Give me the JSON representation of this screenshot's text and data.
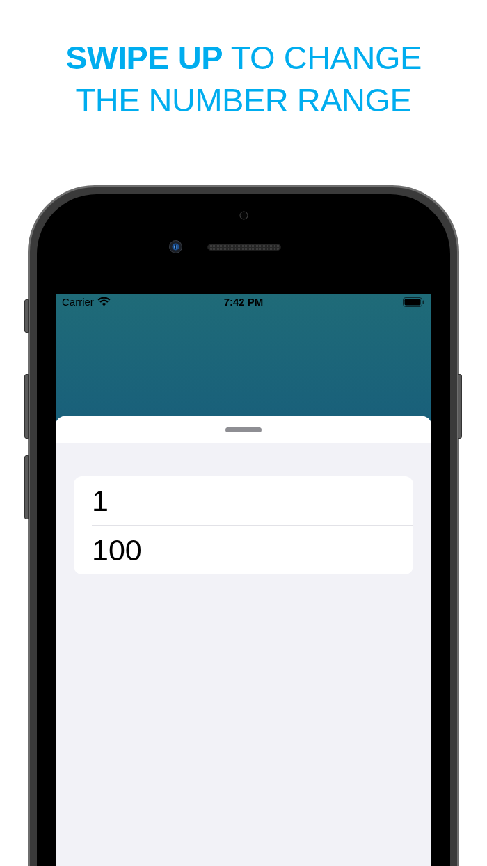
{
  "headline": {
    "lines": [
      "**SWIPE UP** TO CHANGE",
      "THE NUMBER RANGE"
    ]
  },
  "status_bar": {
    "carrier": "Carrier",
    "time": "7:42 PM"
  },
  "range_fields": [
    {
      "value": "1"
    },
    {
      "value": "100"
    }
  ]
}
